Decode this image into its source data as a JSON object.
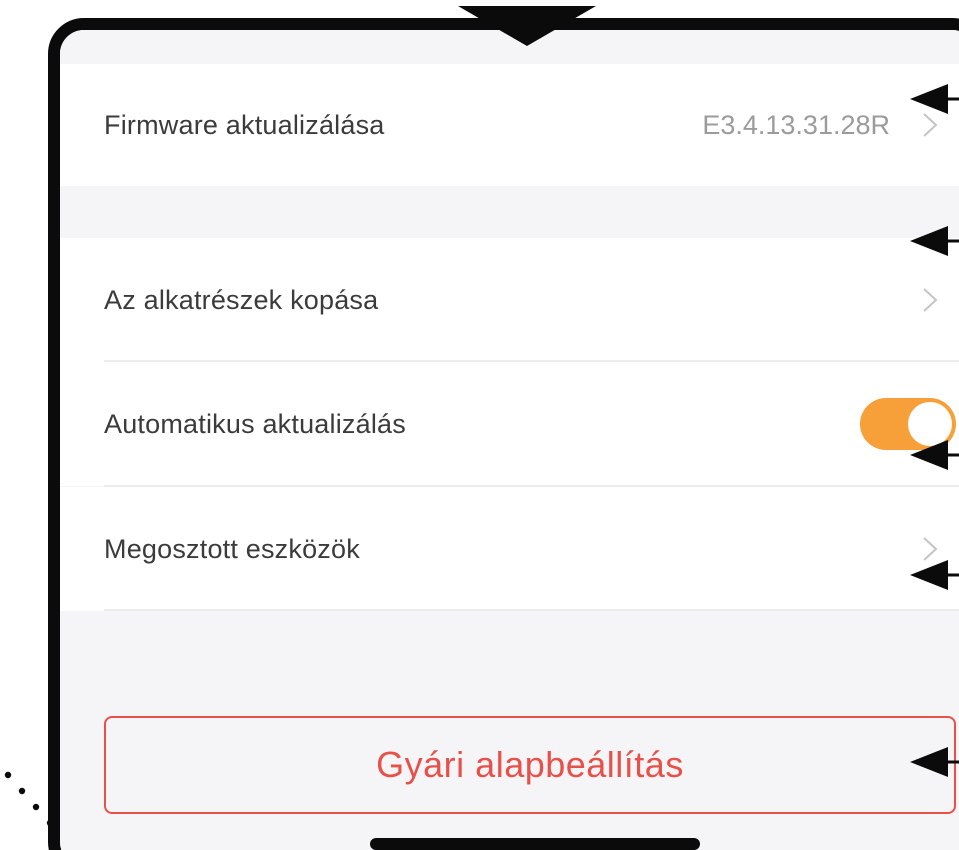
{
  "settings": {
    "firmware": {
      "label": "Firmware aktualizálása",
      "value": "E3.4.13.31.28R"
    },
    "parts_wear": {
      "label": "Az alkatrészek kopása"
    },
    "auto_update": {
      "label": "Automatikus aktualizálás",
      "enabled": true
    },
    "shared_devices": {
      "label": "Megosztott eszközök"
    }
  },
  "reset_button": {
    "label": "Gyári alapbeállítás"
  },
  "colors": {
    "accent_toggle": "#f7a03a",
    "danger": "#e8504a",
    "frame": "#0b0b0b",
    "background": "#f5f5f7"
  }
}
